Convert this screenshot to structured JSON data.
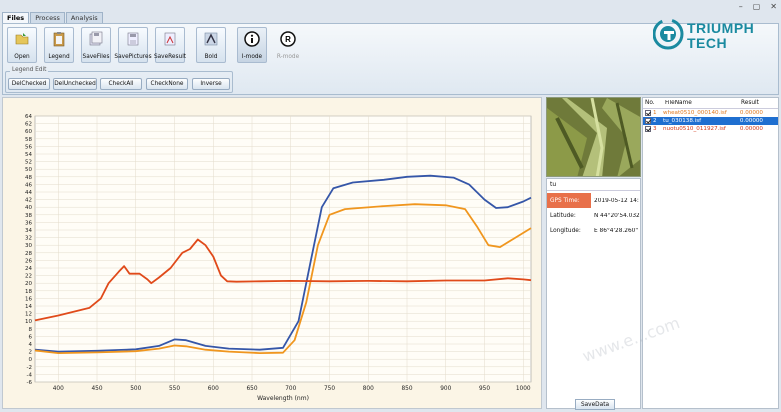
{
  "window": {
    "minimize": "–",
    "maximize": "▢",
    "close": "✕"
  },
  "tabs": [
    "Files",
    "Process",
    "Analysis"
  ],
  "toolbar": {
    "open": "Open",
    "legend": "Legend",
    "savefiles": "SaveFiles",
    "savepictures": "SavePictures",
    "saveresult": "SaveResult",
    "bold": "Bold",
    "imode": "I-mode",
    "rmode": "R-mode"
  },
  "legend_edit": {
    "title": "Legend Edit",
    "buttons": [
      "DelChecked",
      "DelUnchecked",
      "CheckAll",
      "CheckNone",
      "Inverse"
    ]
  },
  "logo": {
    "line1": "TRIUMPH",
    "line2": "TECH",
    "color": "#1a8aa0"
  },
  "info": {
    "title": "tu",
    "rows": [
      {
        "key": "GPS Time:",
        "value": "2019-05-12 14:"
      },
      {
        "key": "Latitude:",
        "value": "N 44°20'54.032"
      },
      {
        "key": "Longitude:",
        "value": "E 86°4'28.260\""
      }
    ],
    "save_label": "SaveData"
  },
  "file_list": {
    "headers": [
      "No.",
      "FileName",
      "Result"
    ],
    "rows": [
      {
        "no": "1",
        "name": "wheat0510_000140.isf",
        "result": "0.00000",
        "color": "#e07a20"
      },
      {
        "no": "2",
        "name": "tu_030138.isf",
        "result": "0.00000",
        "color": "#ffffff"
      },
      {
        "no": "3",
        "name": "nuotu0510_011927.isf",
        "result": "0.00000",
        "color": "#d23a1a"
      }
    ]
  },
  "watermark": "www.e...com",
  "chart_data": {
    "type": "line",
    "xlabel": "Wavelength (nm)",
    "ylabel": "",
    "xlim": [
      370,
      1010
    ],
    "ylim": [
      -6,
      64
    ],
    "xticks": [
      400,
      450,
      500,
      550,
      600,
      650,
      700,
      750,
      800,
      850,
      900,
      950,
      1000
    ],
    "yticks": [
      -6,
      -4,
      -2,
      0,
      2,
      4,
      6,
      8,
      10,
      12,
      14,
      16,
      18,
      20,
      22,
      24,
      26,
      28,
      30,
      32,
      34,
      36,
      38,
      40,
      42,
      44,
      46,
      48,
      50,
      52,
      54,
      56,
      58,
      60,
      62,
      64
    ],
    "grid": true,
    "series": [
      {
        "color": "#3556a8",
        "points": [
          [
            370,
            2.5
          ],
          [
            400,
            2
          ],
          [
            450,
            2.2
          ],
          [
            500,
            2.6
          ],
          [
            530,
            3.5
          ],
          [
            550,
            5.2
          ],
          [
            565,
            5
          ],
          [
            590,
            3.5
          ],
          [
            620,
            2.8
          ],
          [
            660,
            2.5
          ],
          [
            690,
            3
          ],
          [
            710,
            10
          ],
          [
            725,
            25
          ],
          [
            740,
            40
          ],
          [
            755,
            45
          ],
          [
            780,
            46.5
          ],
          [
            820,
            47.2
          ],
          [
            850,
            48
          ],
          [
            880,
            48.3
          ],
          [
            910,
            47.8
          ],
          [
            930,
            46
          ],
          [
            950,
            42
          ],
          [
            965,
            39.8
          ],
          [
            980,
            40
          ],
          [
            1000,
            41.5
          ],
          [
            1010,
            42.5
          ]
        ]
      },
      {
        "color": "#f0961e",
        "points": [
          [
            370,
            2.3
          ],
          [
            400,
            1.6
          ],
          [
            450,
            1.8
          ],
          [
            500,
            2.1
          ],
          [
            530,
            2.8
          ],
          [
            550,
            3.6
          ],
          [
            565,
            3.4
          ],
          [
            590,
            2.5
          ],
          [
            620,
            2
          ],
          [
            660,
            1.6
          ],
          [
            690,
            1.7
          ],
          [
            705,
            5
          ],
          [
            720,
            15
          ],
          [
            735,
            30
          ],
          [
            750,
            38
          ],
          [
            770,
            39.5
          ],
          [
            820,
            40.3
          ],
          [
            860,
            40.8
          ],
          [
            900,
            40.5
          ],
          [
            925,
            39.5
          ],
          [
            940,
            35
          ],
          [
            955,
            30
          ],
          [
            970,
            29.5
          ],
          [
            990,
            32
          ],
          [
            1010,
            34.5
          ]
        ]
      },
      {
        "color": "#e04a1a",
        "points": [
          [
            370,
            10.2
          ],
          [
            400,
            11.5
          ],
          [
            440,
            13.5
          ],
          [
            455,
            16
          ],
          [
            465,
            20
          ],
          [
            478,
            23
          ],
          [
            485,
            24.5
          ],
          [
            492,
            22.5
          ],
          [
            505,
            22.5
          ],
          [
            515,
            21
          ],
          [
            520,
            20
          ],
          [
            530,
            21.5
          ],
          [
            545,
            24
          ],
          [
            560,
            28
          ],
          [
            570,
            29
          ],
          [
            580,
            31.5
          ],
          [
            590,
            30
          ],
          [
            600,
            27
          ],
          [
            610,
            22
          ],
          [
            618,
            20.5
          ],
          [
            630,
            20.4
          ],
          [
            660,
            20.5
          ],
          [
            700,
            20.6
          ],
          [
            750,
            20.5
          ],
          [
            800,
            20.6
          ],
          [
            850,
            20.5
          ],
          [
            900,
            20.7
          ],
          [
            950,
            20.7
          ],
          [
            980,
            21.3
          ],
          [
            1000,
            21
          ],
          [
            1010,
            20.8
          ]
        ]
      }
    ]
  }
}
